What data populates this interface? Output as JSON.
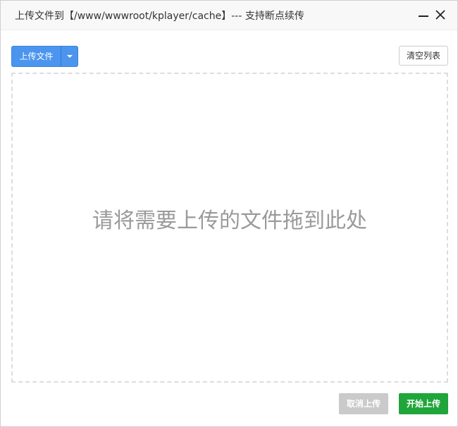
{
  "dialog": {
    "title": "上传文件到【/www/wwwroot/kplayer/cache】--- 支持断点续传",
    "minimize_icon": "minimize-icon",
    "close_icon": "close-icon"
  },
  "toolbar": {
    "upload_label": "上传文件",
    "dropdown_icon": "caret-down-icon",
    "clear_label": "清空列表"
  },
  "dropzone": {
    "hint": "请将需要上传的文件拖到此处"
  },
  "footer": {
    "cancel_label": "取消上传",
    "start_label": "开始上传"
  },
  "colors": {
    "primary_blue": "#4c95ef",
    "start_green": "#20a53a",
    "disabled_gray": "#cacaca"
  }
}
